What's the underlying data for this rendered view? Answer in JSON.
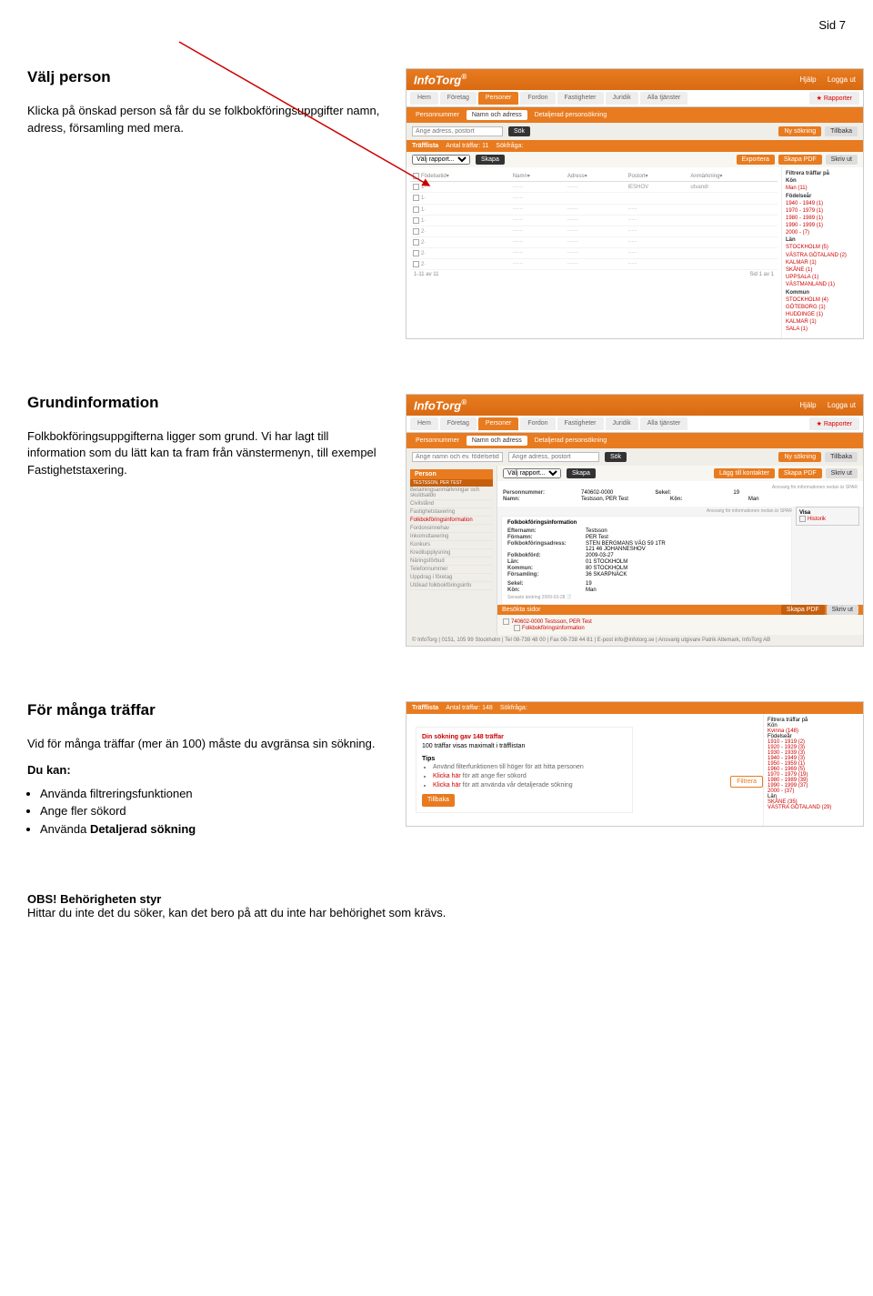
{
  "page_number_label": "Sid 7",
  "common": {
    "logo": "InfoTorg",
    "hdr_help": "Hjälp",
    "hdr_logout": "Logga ut",
    "tabs": [
      "Hem",
      "Företag",
      "Personer",
      "Fordon",
      "Fastigheter",
      "Juridik",
      "Alla tjänster"
    ],
    "tab_reports": "Rapporter",
    "subtabs": [
      "Personnummer",
      "Namn och adress",
      "Detaljerad personsökning"
    ],
    "search_placeholder1": "Ange namn och ev. födelsetid",
    "search_placeholder2": "Ange adress, postort",
    "btn_search": "Sök",
    "btn_new_search": "Ny sökning",
    "btn_back": "Tillbaka",
    "btn_export": "Exportera",
    "btn_pdf": "Skapa PDF",
    "btn_print": "Skriv ut",
    "report_label": "Välj rapport...",
    "btn_create": "Skapa"
  },
  "section1": {
    "title": "Välj person",
    "body": "Klicka på önskad person så får du se folkbokföringsuppgifter namn, adress, församling med mera.",
    "shot": {
      "band_label": "Träfflista",
      "band_count": "Antal träffar: 11",
      "band_query": "Sökfråga:",
      "cols": [
        "Födelsetid",
        "Namn",
        "Adress",
        "Postort",
        "Anmärkning"
      ],
      "rows": [
        {
          "ft": "1",
          "a": "IESHOV",
          "rem": "utvandr"
        },
        {
          "ft": "1"
        },
        {
          "ft": "1"
        },
        {
          "ft": "2"
        },
        {
          "ft": "2"
        },
        {
          "ft": "2"
        },
        {
          "ft": "2"
        },
        {
          "ft": "2"
        }
      ],
      "pager_left": "1-11 av 11",
      "pager_right": "Sid 1 av 1",
      "filter_title": "Filtrera träffar på",
      "filters": {
        "Kön": [
          "Man (11)"
        ],
        "Födelseår": [
          "1940 - 1949 (1)",
          "1970 - 1979 (1)",
          "1980 - 1989 (1)",
          "1990 - 1999 (1)",
          "2000 - (7)"
        ],
        "Län": [
          "STOCKHOLM (5)",
          "VÄSTRA GÖTALAND (2)",
          "KALMAR (1)",
          "SKÅNE (1)",
          "UPPSALA (1)",
          "VÄSTMANLAND (1)"
        ],
        "Kommun": [
          "STOCKHOLM (4)",
          "GÖTEBORG (1)",
          "HUDDINGE (1)",
          "KALMAR (1)",
          "SALA (1)"
        ]
      }
    }
  },
  "section2": {
    "title": "Grundinformation",
    "body": "Folkbokföringsuppgifterna ligger som grund. Vi har lagt till information som du lätt kan ta fram från vänstermenyn, till exempel Fastighetstaxering.",
    "shot": {
      "person_band": "Person",
      "person_sub": "TESTSSON, PER TEST",
      "btn_contacts": "Lägg till kontakter",
      "menu": [
        "Betalningsanmärkningar och skuldsaldo",
        "Civilstånd",
        "Fastighetstaxering",
        "Folkbokföringsinformation",
        "Fordonsinnehav",
        "Inkomsttaxering",
        "Konkurs",
        "Kreditupplysning",
        "Näringsförbud",
        "Telefonnummer",
        "Uppdrag i företag",
        "Utökad folkbokföringsinfo"
      ],
      "pnr_label": "Personnummer:",
      "pnr": "740602-0000",
      "sekel_label": "Sekel:",
      "sekel": "19",
      "namn_label": "Namn:",
      "namn": "Testsson, PER Test",
      "kon_label": "Kön:",
      "kon": "Man",
      "spar_note": "Ansvarig för informationen nedan är SPAR",
      "fbi_title": "Folkbokföringsinformation",
      "visa_title": "Visa",
      "visa_items": [
        "Historik"
      ],
      "fields": {
        "Efternamn:": "Testsson",
        "Förnamn:": "PER Test",
        "Folkbokföringsadress:": "STEN BERGMANS VÄG 59 1TR\n121 46 JOHANNESHOV",
        "Folkbokförd:": "2009-03-27",
        "Län:": "01 STOCKHOLM",
        "Kommun:": "80 STOCKHOLM",
        "Församling:": "36 SKARPNÄCK",
        "Sekel:": "19",
        "Kön:": "Man"
      },
      "changed": "Senaste ändring 2009-03-28",
      "visited_band": "Besökta sidor",
      "visited_item1": "740602-0000 Testsson, PER Test",
      "visited_item2": "Folkbokföringsinformation",
      "footer": "© InfoTorg | 0151, 105 99 Stockholm | Tel 08-738 48 00 | Fax 08-738 44 81 | E-post info@infotorg.se | Ansvarig utgivare Patrik Attemark, InfoTorg AB"
    }
  },
  "section3": {
    "title": "För många träffar",
    "body": "Vid för många träffar (mer än 100) måste du avgränsa sin sökning.",
    "dukankan": "Du kan:",
    "bullets": [
      "Använda filtreringsfunktionen",
      "Ange fler sökord",
      "Använda Detaljerad sökning"
    ],
    "shot": {
      "band_label": "Träfflista",
      "band_count": "Antal träffar: 148",
      "band_query": "Sökfråga:",
      "tips_l1": "Din sökning gav 148 träffar",
      "tips_l2": "100 träffar visas maximalt i träfflistan",
      "tips_head": "Tips",
      "tips_items": [
        "Använd filterfunktionen till höger för att hitta personen",
        "Klicka här för att ange fler sökord",
        "Klicka här för att använda vår detaljerade sökning"
      ],
      "btn_back": "Tillbaka",
      "btn_filter": "Filtrera",
      "filter_title": "Filtrera träffar på",
      "filters": {
        "Kön": [
          "Kvinna (148)"
        ],
        "Födelseår": [
          "1910 - 1919 (2)",
          "1920 - 1929 (3)",
          "1930 - 1939 (3)",
          "1940 - 1949 (3)",
          "1950 - 1959 (1)",
          "1960 - 1969 (5)",
          "1970 - 1979 (19)",
          "1980 - 1989 (39)",
          "1990 - 1999 (37)",
          "2000 - (37)"
        ],
        "Län": [
          "SKÅNE (35)",
          "VÄSTRA GÖTALAND (29)"
        ]
      }
    }
  },
  "footer": {
    "bold": "OBS! Behörigheten styr",
    "text": "Hittar du inte det du söker, kan det bero på att du inte har behörighet som krävs."
  }
}
